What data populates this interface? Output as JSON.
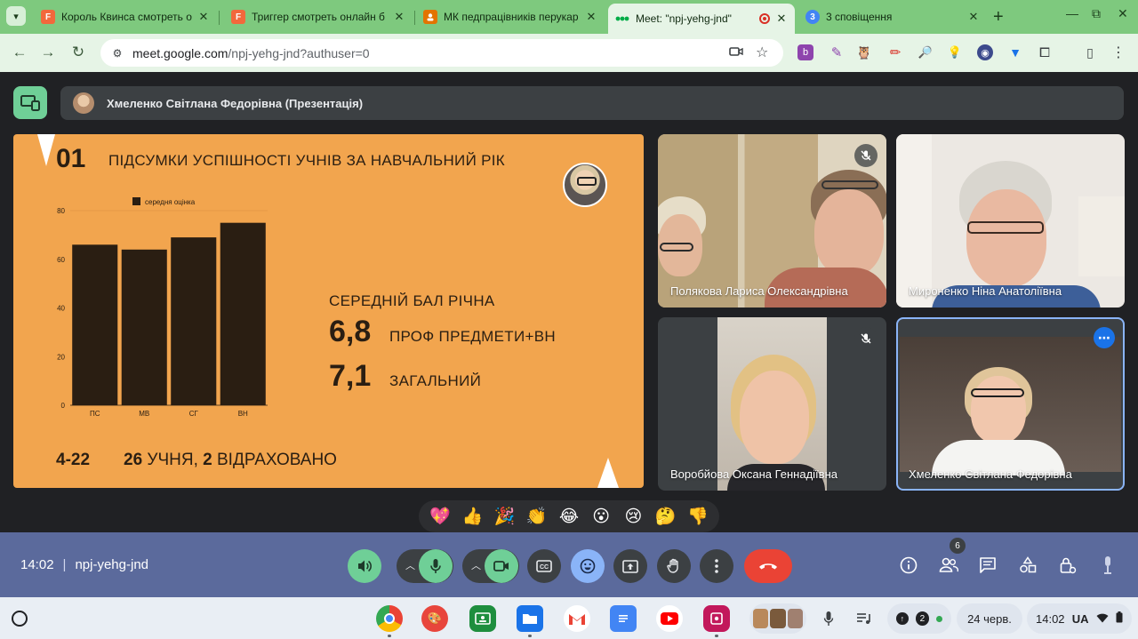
{
  "browser": {
    "tabs": [
      {
        "title": "Король Квинса смотреть он",
        "favicon_letter": "F",
        "favicon_color": "#f2683c"
      },
      {
        "title": "Триггер смотреть онлайн б",
        "favicon_letter": "F",
        "favicon_color": "#f2683c"
      },
      {
        "title": "МК педпрацівників перукар",
        "favicon_letter": "",
        "favicon_color": "#e37400"
      },
      {
        "title": "Meet: \"npj-yehg-jnd\"",
        "favicon_letter": "",
        "favicon_color": "#00ac47"
      },
      {
        "title": "3 сповіщення",
        "favicon_letter": "3",
        "favicon_color": "#4285f4"
      }
    ],
    "address": {
      "host": "meet.google.com",
      "path": "/npj-yehg-jnd?authuser=0"
    }
  },
  "meet": {
    "presenter_banner": "Хмеленко Світлана Федорівна (Презентація)",
    "participants": [
      {
        "name": "Полякова Лариса Олександрівна",
        "muted": true
      },
      {
        "name": "Мироненко Ніна Анатоліївна",
        "muted": false
      },
      {
        "name": "Воробйова Оксана Геннадіївна",
        "muted": true
      },
      {
        "name": "Хмеленко Світлана Федорівна",
        "muted": false
      }
    ],
    "reactions": [
      "💖",
      "👍",
      "🎉",
      "👏",
      "😂",
      "😮",
      "😢",
      "🤔",
      "👎"
    ],
    "time": "14:02",
    "meeting_code": "npj-yehg-jnd",
    "participant_count": "6",
    "colors": {
      "control_bar": "#5b6a9c",
      "mic_on": "#6fcf97",
      "end_call": "#ea4335"
    }
  },
  "slide": {
    "number": "01",
    "title": "ПІДСУМКИ УСПІШНОСТІ УЧНІВ ЗА НАВЧАЛЬНИЙ РІК",
    "stats_heading": "СЕРЕДНІЙ БАЛ РІЧНА",
    "stats": [
      {
        "value": "6,8",
        "label": "ПРОФ ПРЕДМЕТИ+ВН"
      },
      {
        "value": "7,1",
        "label": "ЗАГАЛЬНИЙ"
      }
    ],
    "footer": {
      "grades": "4-22",
      "count": "26",
      "text_mid": " УЧНЯ, ",
      "expelled": "2",
      "text_end": " ВІДРАХОВАНО"
    },
    "background": "#f2a54e"
  },
  "chart_data": {
    "type": "bar",
    "categories": [
      "ПС",
      "МВ",
      "СГ",
      "ВН"
    ],
    "series": [
      {
        "name": "середня оцінка",
        "values": [
          66,
          64,
          69,
          75
        ]
      }
    ],
    "ylim": [
      0,
      80
    ],
    "yticks": [
      0,
      20,
      40,
      60,
      80
    ],
    "legend": "top",
    "grid": false,
    "bar_color": "#2a1e12"
  },
  "shelf": {
    "apps": [
      "Chrome",
      "Palette",
      "Classroom",
      "Files",
      "Gmail",
      "Docs",
      "YouTube",
      "Jamboard"
    ],
    "date": "24 черв.",
    "clock": "14:02",
    "locale": "UA",
    "notifications": "2"
  }
}
